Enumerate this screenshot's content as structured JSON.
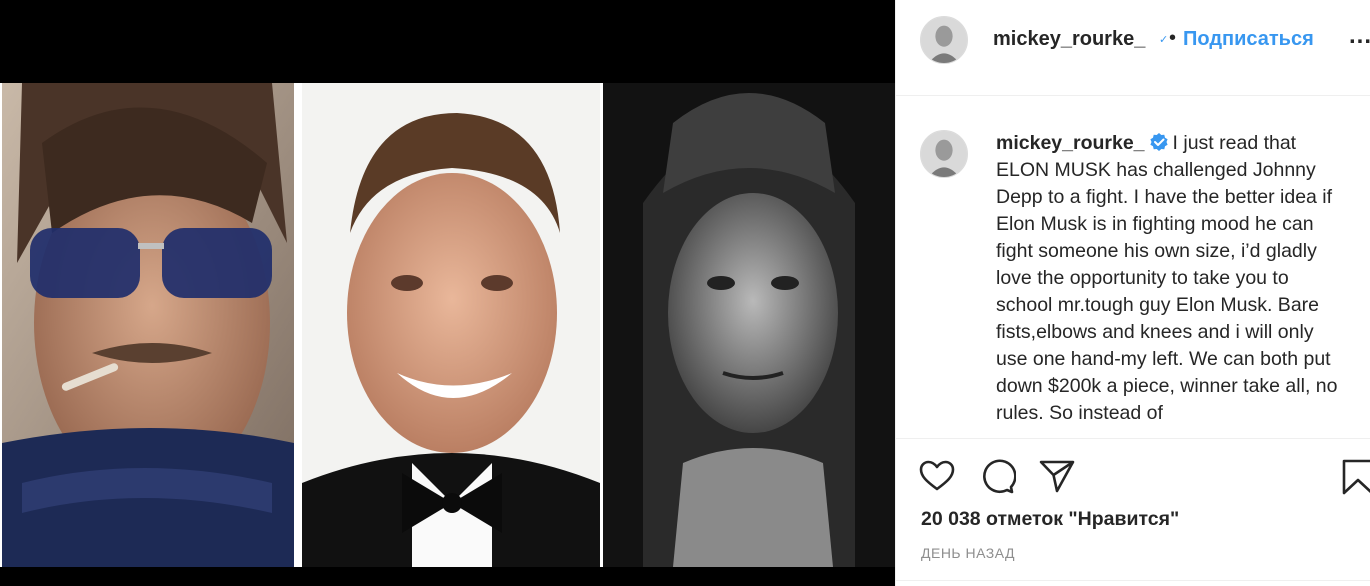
{
  "post": {
    "author": {
      "username": "mickey_rourke_",
      "verified": true
    },
    "follow_label": "Подписаться",
    "separator": "•",
    "more_label": "...",
    "caption": {
      "username": "mickey_rourke_",
      "text": "I just read that ELON MUSK has challenged Johnny Depp to a fight. I have the better idea if Elon Musk is in fighting mood he can fight someone his own size, i’d gladly love the opportunity to take you to school mr.tough guy Elon Musk. Bare fists,elbows and knees and i will only use one hand-my left. We can both put down $200k a piece, winner take all, no rules. So instead of"
    },
    "likes_label": "20 038 отметок \"Нравится\"",
    "timestamp": "День назад",
    "icons": {
      "like": "heart-icon",
      "comment": "comment-bubble-icon",
      "share": "paper-plane-icon",
      "save": "bookmark-icon",
      "verified": "verified-check-icon",
      "more": "ellipsis-icon"
    },
    "colors": {
      "accent": "#3897f0",
      "text": "#262626",
      "muted": "#8e8e8e",
      "border": "#efefef",
      "media_background": "#000000"
    }
  }
}
